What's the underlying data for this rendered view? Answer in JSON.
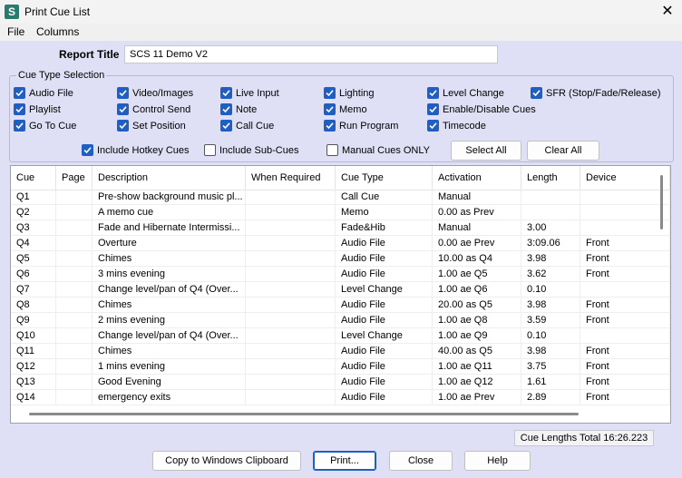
{
  "window": {
    "title": "Print Cue List",
    "app_icon": "scs-app-icon",
    "close_glyph": "✕"
  },
  "menu": [
    "File",
    "Columns"
  ],
  "report": {
    "label": "Report Title",
    "value": "SCS 11 Demo V2"
  },
  "cue_type_selection": {
    "legend": "Cue Type Selection",
    "checkboxes": [
      {
        "label": "Audio File",
        "checked": true
      },
      {
        "label": "Video/Images",
        "checked": true
      },
      {
        "label": "Live Input",
        "checked": true
      },
      {
        "label": "Lighting",
        "checked": true
      },
      {
        "label": "Level Change",
        "checked": true
      },
      {
        "label": "SFR (Stop/Fade/Release)",
        "checked": true
      },
      {
        "label": "Playlist",
        "checked": true
      },
      {
        "label": "Control Send",
        "checked": true
      },
      {
        "label": "Note",
        "checked": true
      },
      {
        "label": "Memo",
        "checked": true
      },
      {
        "label": "Enable/Disable Cues",
        "checked": true
      },
      {
        "label": "Go To Cue",
        "checked": true
      },
      {
        "label": "Set Position",
        "checked": true
      },
      {
        "label": "Call Cue",
        "checked": true
      },
      {
        "label": "Run Program",
        "checked": true
      },
      {
        "label": "Timecode",
        "checked": true
      }
    ],
    "options": [
      {
        "label": "Include Hotkey Cues",
        "checked": true
      },
      {
        "label": "Include Sub-Cues",
        "checked": false
      },
      {
        "label": "Manual Cues ONLY",
        "checked": false
      }
    ],
    "select_all": "Select All",
    "clear_all": "Clear All"
  },
  "grid": {
    "columns": [
      "Cue",
      "Page",
      "Description",
      "When Required",
      "Cue Type",
      "Activation",
      "Length",
      "Device"
    ],
    "rows": [
      [
        "Q1",
        "",
        "Pre-show background music pl...",
        "",
        "Call Cue",
        "Manual",
        "",
        ""
      ],
      [
        "Q2",
        "",
        "A memo cue",
        "",
        "Memo",
        "0.00 as Prev",
        "",
        ""
      ],
      [
        "Q3",
        "",
        "Fade and Hibernate Intermissi...",
        "",
        "Fade&Hib",
        "Manual",
        "3.00",
        ""
      ],
      [
        "Q4",
        "",
        "Overture",
        "",
        "Audio File",
        "0.00 ae Prev",
        "3:09.06",
        "Front"
      ],
      [
        "Q5",
        "",
        "Chimes",
        "",
        "Audio File",
        "10.00 as Q4",
        "3.98",
        "Front"
      ],
      [
        "Q6",
        "",
        "3 mins evening",
        "",
        "Audio File",
        "1.00 ae Q5",
        "3.62",
        "Front"
      ],
      [
        "Q7",
        "",
        "Change level/pan of Q4 (Over...",
        "",
        "Level Change",
        "1.00 ae Q6",
        "0.10",
        ""
      ],
      [
        "Q8",
        "",
        "Chimes",
        "",
        "Audio File",
        "20.00 as Q5",
        "3.98",
        "Front"
      ],
      [
        "Q9",
        "",
        "2 mins evening",
        "",
        "Audio File",
        "1.00 ae Q8",
        "3.59",
        "Front"
      ],
      [
        "Q10",
        "",
        "Change level/pan of Q4 (Over...",
        "",
        "Level Change",
        "1.00 ae Q9",
        "0.10",
        ""
      ],
      [
        "Q11",
        "",
        "Chimes",
        "",
        "Audio File",
        "40.00 as Q5",
        "3.98",
        "Front"
      ],
      [
        "Q12",
        "",
        "1 mins evening",
        "",
        "Audio File",
        "1.00 ae Q11",
        "3.75",
        "Front"
      ],
      [
        "Q13",
        "",
        "Good Evening",
        "",
        "Audio File",
        "1.00 ae Q12",
        "1.61",
        "Front"
      ],
      [
        "Q14",
        "",
        "emergency exits",
        "",
        "Audio File",
        "1.00 ae Prev",
        "2.89",
        "Front"
      ]
    ]
  },
  "totals": "Cue Lengths Total 16:26.223",
  "buttons": {
    "copy": "Copy to Windows Clipboard",
    "print": "Print...",
    "close": "Close",
    "help": "Help"
  },
  "colors": {
    "accent": "#1f5fc4",
    "dialog_bg": "#dfe0f5"
  }
}
